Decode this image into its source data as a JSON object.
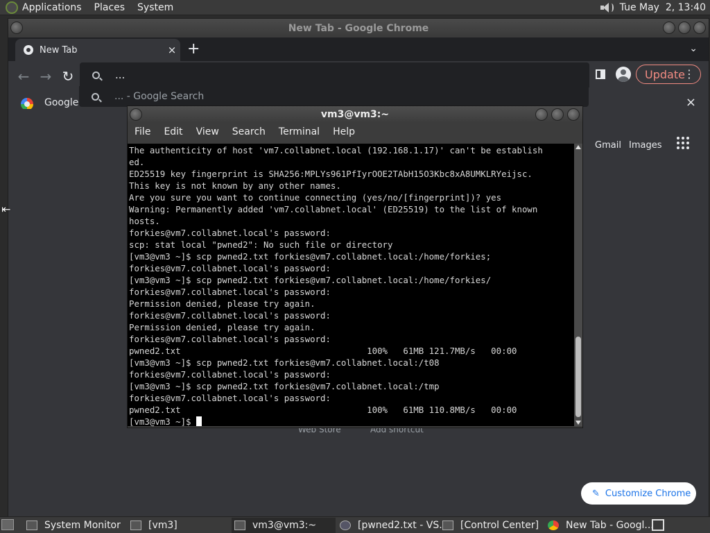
{
  "top_panel": {
    "menus": [
      "Applications",
      "Places",
      "System"
    ],
    "clock": "Tue May  2, 13:40",
    "logo_icon": "distro-logo-icon",
    "volume_icon": "volume-icon"
  },
  "chrome": {
    "window_title": "New Tab - Google Chrome",
    "tab": {
      "label": "New Tab",
      "close": "×"
    },
    "new_tab": "+",
    "tab_menu": "⌄",
    "nav": {
      "back": "←",
      "forward": "→",
      "reload": "↻"
    },
    "omnibox_text": "...",
    "suggestion_text": "... - Google Search",
    "update_label": "Update",
    "menu_dots": "⋮",
    "bookmark_google": "Google",
    "bookmark_close": "×",
    "content": {
      "gmail": "Gmail",
      "images": "Images",
      "shortcut_1": "Web Store",
      "shortcut_2": "Add shortcut",
      "customize_label": "Customize Chrome",
      "customize_icon": "✎"
    }
  },
  "terminal": {
    "title": "vm3@vm3:~",
    "menus": [
      "File",
      "Edit",
      "View",
      "Search",
      "Terminal",
      "Help"
    ],
    "lines": [
      "The authenticity of host 'vm7.collabnet.local (192.168.1.17)' can't be establish",
      "ed.",
      "ED25519 key fingerprint is SHA256:MPLYs961PfIyrOOE2TAbH15O3Kbc8xA8UMKLRYeijsc.",
      "This key is not known by any other names.",
      "Are you sure you want to continue connecting (yes/no/[fingerprint])? yes",
      "Warning: Permanently added 'vm7.collabnet.local' (ED25519) to the list of known",
      "hosts.",
      "forkies@vm7.collabnet.local's password:",
      "scp: stat local \"pwned2\": No such file or directory",
      "[vm3@vm3 ~]$ scp pwned2.txt forkies@vm7.collabnet.local:/home/forkies;",
      "forkies@vm7.collabnet.local's password:",
      "[vm3@vm3 ~]$ scp pwned2.txt forkies@vm7.collabnet.local:/home/forkies/",
      "forkies@vm7.collabnet.local's password:",
      "Permission denied, please try again.",
      "forkies@vm7.collabnet.local's password:",
      "Permission denied, please try again.",
      "forkies@vm7.collabnet.local's password:",
      "pwned2.txt                                    100%   61MB 121.7MB/s   00:00",
      "[vm3@vm3 ~]$ scp pwned2.txt forkies@vm7.collabnet.local:/t08",
      "forkies@vm7.collabnet.local's password:",
      "[vm3@vm3 ~]$ scp pwned2.txt forkies@vm7.collabnet.local:/tmp",
      "forkies@vm7.collabnet.local's password:",
      "pwned2.txt                                    100%   61MB 110.8MB/s   00:00"
    ],
    "prompt": "[vm3@vm3 ~]$ "
  },
  "taskbar": {
    "items": [
      {
        "label": "System Monitor",
        "icon": "system-monitor-icon"
      },
      {
        "label": "[vm3]",
        "icon": "folder-icon"
      },
      {
        "label": "vm3@vm3:~",
        "icon": "terminal-icon"
      },
      {
        "label": "[pwned2.txt - VS...",
        "icon": "vscode-icon"
      },
      {
        "label": "[Control Center]",
        "icon": "control-center-icon"
      },
      {
        "label": "New Tab - Googl...",
        "icon": "chrome-icon"
      }
    ]
  }
}
